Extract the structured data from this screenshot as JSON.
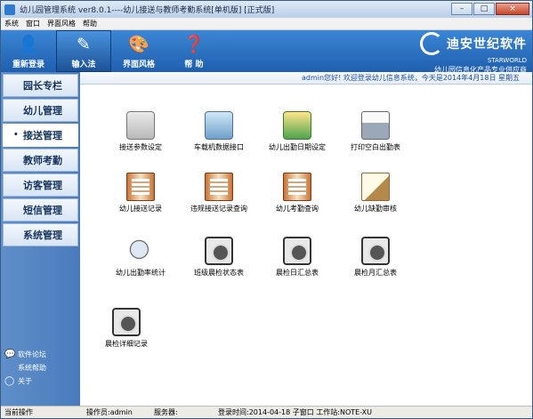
{
  "window": {
    "title": "幼儿园管理系统 ver8.0.1----幼儿接送与教师考勤系统[单机版] [正式版]",
    "controls": [
      "–",
      "□",
      "×"
    ]
  },
  "menubar": [
    "系统",
    "窗口",
    "界面风格",
    "帮助"
  ],
  "toolbar": {
    "buttons": [
      {
        "label": "重新登录",
        "icon": "user-login-icon"
      },
      {
        "label": "输入法",
        "icon": "input-method-icon"
      },
      {
        "label": "界面风格",
        "icon": "palette-icon"
      },
      {
        "label": "帮 助",
        "icon": "help-icon"
      }
    ],
    "active_index": 1
  },
  "brand": {
    "name": "迪安世纪软件",
    "sub": "STARWORLD",
    "slogan": "幼儿园信息化产品专业供应商"
  },
  "sidebar": {
    "items": [
      {
        "label": "园长专栏"
      },
      {
        "label": "幼儿管理"
      },
      {
        "label": "接送管理"
      },
      {
        "label": "教师考勤"
      },
      {
        "label": "访客管理"
      },
      {
        "label": "短信管理"
      },
      {
        "label": "系统管理"
      }
    ],
    "active_index": 2,
    "footer": [
      {
        "label": "软件论坛",
        "icon": "forum-icon"
      },
      {
        "label": "系统帮助",
        "icon": "help-icon"
      },
      {
        "label": "关于",
        "icon": "about-icon"
      }
    ]
  },
  "welcome": "admin您好! 欢迎登录幼儿信息系统，今天是2014年4月18日 星期五",
  "functions": [
    {
      "label": "接送参数设定",
      "icon": "settings-computer-icon"
    },
    {
      "label": "车载机数据接口",
      "icon": "card-reader-icon"
    },
    {
      "label": "幼儿出勤日期设定",
      "icon": "calendar-settings-icon"
    },
    {
      "label": "打印空白出勤表",
      "icon": "printer-icon"
    },
    {
      "label": "幼儿接送记录",
      "icon": "record-book-icon"
    },
    {
      "label": "违规接送记录查询",
      "icon": "record-book-icon"
    },
    {
      "label": "幼儿考勤查询",
      "icon": "record-book-icon"
    },
    {
      "label": "幼儿缺勤审核",
      "icon": "write-icon"
    },
    {
      "label": "幼儿出勤率统计",
      "icon": "statistics-magnifier-icon"
    },
    {
      "label": "班级晨检状态表",
      "icon": "checkup-icon"
    },
    {
      "label": "晨检日汇总表",
      "icon": "checkup-icon"
    },
    {
      "label": "晨检月汇总表",
      "icon": "checkup-icon"
    },
    {
      "label": "晨检详细记录",
      "icon": "checkup-icon"
    }
  ],
  "statusbar": {
    "left": "当前操作",
    "operator": "操作员:admin",
    "server": "服务器:",
    "login_time": "登录时间:2014-04-18 子窗口 工作站:NOTE-XU"
  }
}
